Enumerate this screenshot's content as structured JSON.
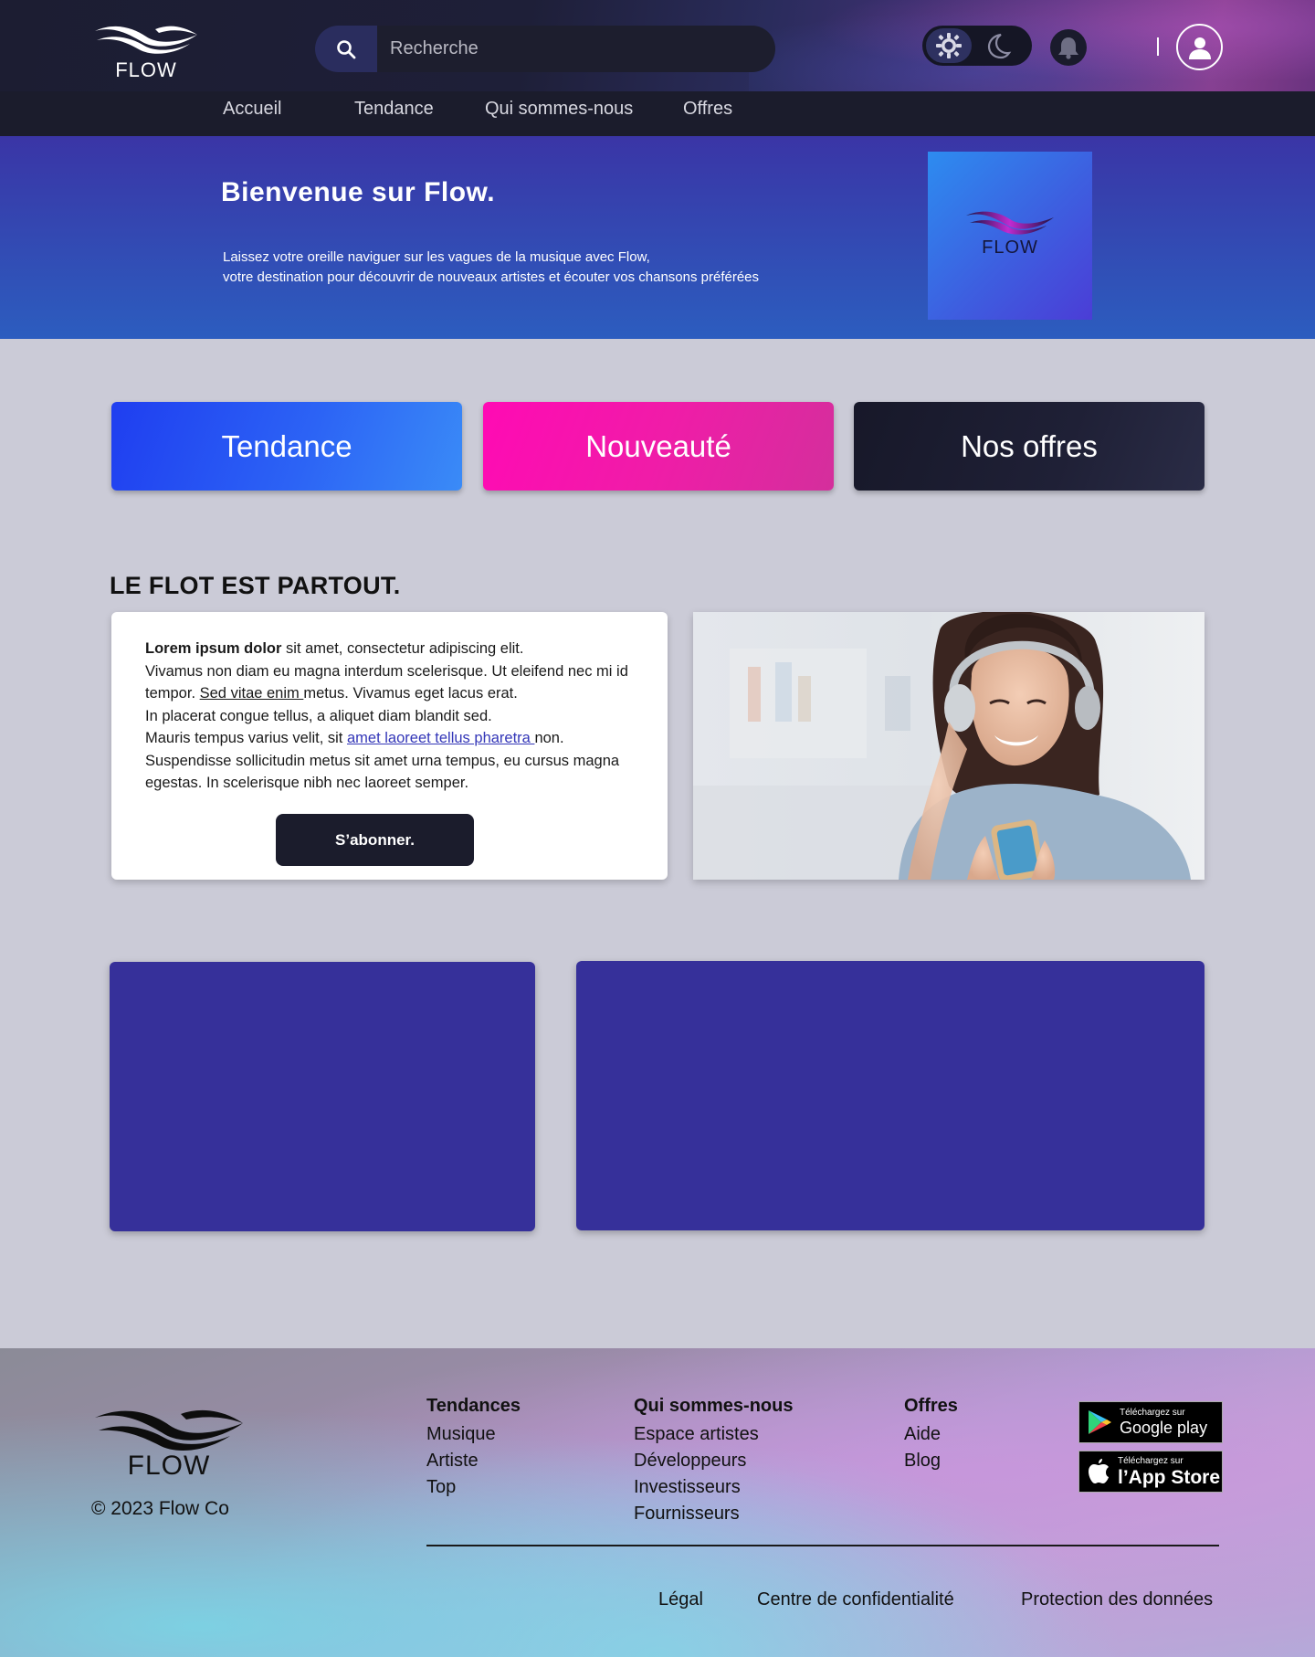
{
  "header": {
    "logo_text": "FLOW",
    "search": {
      "placeholder": "Recherche"
    },
    "nav": [
      "Accueil",
      "Tendance",
      "Qui sommes-nous",
      "Offres"
    ]
  },
  "hero": {
    "title": "Bienvenue sur Flow.",
    "text_line1": "Laissez votre oreille naviguer sur les vagues de la musique avec Flow,",
    "text_line2": "votre destination pour découvrir de nouveaux artistes et écouter vos chansons préférées",
    "logo_text": "FLOW"
  },
  "categories": [
    "Tendance",
    "Nouveauté",
    "Nos offres"
  ],
  "section": {
    "title": "LE FLOT EST PARTOUT.",
    "p_bold": "Lorem ipsum dolor",
    "p1": " sit amet, consectetur adipiscing elit.",
    "p2": "Vivamus non diam eu magna interdum scelerisque. Ut eleifend nec mi id tempor. ",
    "link1": "Sed vitae enim ",
    "p3": "metus. Vivamus eget lacus erat.",
    "p4": "In placerat congue tellus, a aliquet diam blandit sed.",
    "p5": "Mauris tempus varius velit, sit ",
    "link2": "amet laoreet tellus pharetra ",
    "p6": "non.",
    "p7": "Suspendisse sollicitudin metus sit amet urna tempus, eu cursus magna egestas. In scelerisque nibh nec laoreet semper.",
    "subscribe": "S’abonner."
  },
  "footer": {
    "logo_text": "FLOW",
    "copyright": "© 2023 Flow Co",
    "col1": {
      "head": "Tendances",
      "links": [
        "Musique",
        "Artiste",
        "Top"
      ]
    },
    "col2": {
      "head": "Qui sommes-nous",
      "links": [
        "Espace artistes",
        "Développeurs",
        "Investisseurs",
        "Fournisseurs"
      ]
    },
    "col3": {
      "head": "Offres",
      "links": [
        "Aide",
        "Blog"
      ]
    },
    "google_play": {
      "small": "Téléchargez sur",
      "big": "Google play"
    },
    "app_store": {
      "small": "Téléchargez sur",
      "big": "l’App Store"
    },
    "legal": [
      "Légal",
      "Centre de confidentialité",
      "Protection des données"
    ]
  },
  "colors": {
    "brand_dark": "#1b1c2c",
    "tendance": "#2c63f5",
    "nouveaute": "#ff0ab4",
    "block": "#36309a"
  },
  "icons": [
    "search-icon",
    "sun-icon",
    "moon-icon",
    "bell-icon",
    "user-icon",
    "google-play-icon",
    "apple-icon"
  ]
}
